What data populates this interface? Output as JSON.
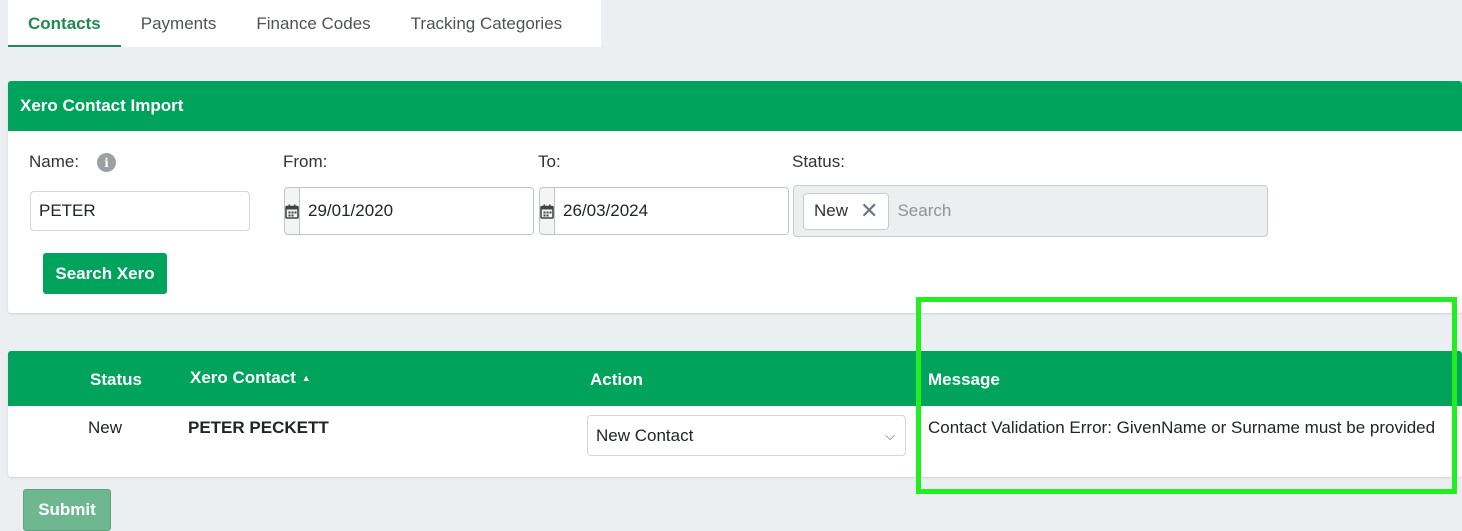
{
  "tabs": [
    {
      "label": "Contacts",
      "active": true
    },
    {
      "label": "Payments",
      "active": false
    },
    {
      "label": "Finance Codes",
      "active": false
    },
    {
      "label": "Tracking Categories",
      "active": false
    }
  ],
  "import_card": {
    "title": "Xero Contact Import",
    "name_label": "Name:",
    "name_value": "PETER",
    "from_label": "From:",
    "from_value": "29/01/2020",
    "to_label": "To:",
    "to_value": "26/03/2024",
    "status_label": "Status:",
    "status_chip": "New",
    "status_placeholder": "Search",
    "search_button": "Search Xero"
  },
  "results": {
    "columns": {
      "status": "Status",
      "contact": "Xero Contact",
      "action": "Action",
      "message": "Message"
    },
    "rows": [
      {
        "status": "New",
        "contact": "PETER PECKETT",
        "action": "New Contact",
        "message": "Contact Validation Error: GivenName or Surname must be provided"
      }
    ]
  },
  "submit_button": "Submit",
  "colors": {
    "brand_green": "#00a35c",
    "highlight": "#22ee22"
  },
  "icons": [
    "info-icon",
    "calendar-icon",
    "close-icon",
    "sort-ascending-icon",
    "chevron-down-icon"
  ]
}
